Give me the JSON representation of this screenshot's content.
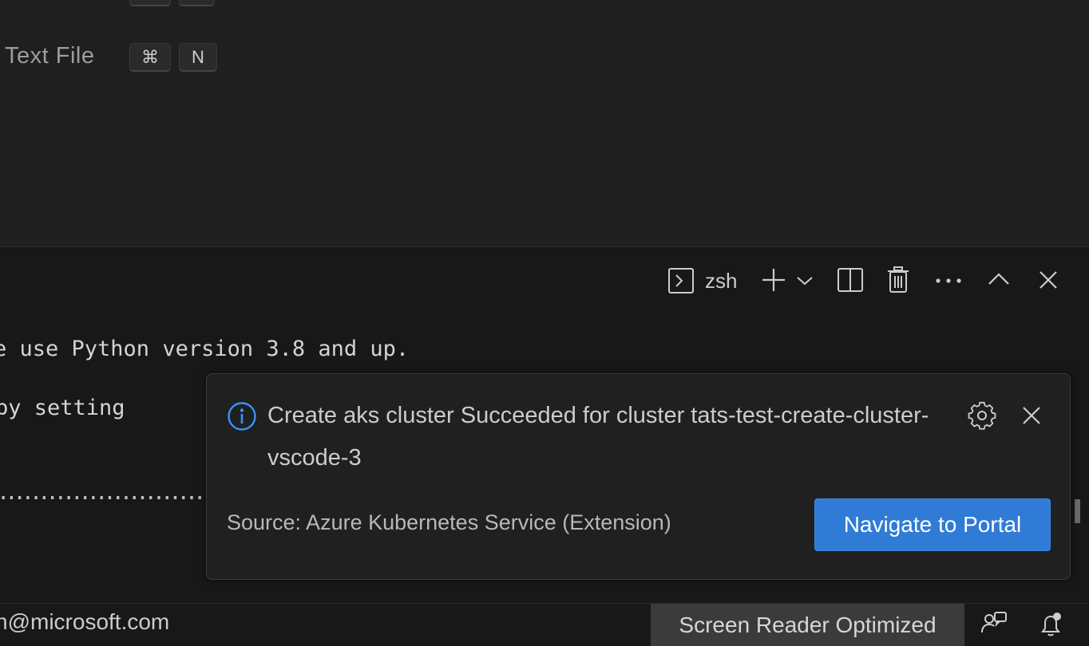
{
  "editor": {
    "shortcuts_top": [
      "",
      ""
    ],
    "new_file_label": "Text File",
    "new_file_keys": [
      "⌘",
      "N"
    ]
  },
  "terminal": {
    "shell_label": "zsh",
    "toolbar": {
      "terminal_icon": "terminal-icon",
      "new_terminal_icon": "plus-icon",
      "dropdown_icon": "chevron-down-icon",
      "split_icon": "split-terminal-icon",
      "kill_icon": "trash-icon",
      "more_icon": "ellipsis-icon",
      "maximize_icon": "chevron-up-icon",
      "close_icon": "close-icon"
    },
    "lines": [
      "e use Python version 3.8 and up.",
      "by setting",
      "..........................."
    ]
  },
  "notification": {
    "info_icon": "info-icon",
    "message": "Create aks cluster Succeeded for cluster tats-test-create-cluster-vscode-3",
    "source": "Source: Azure Kubernetes Service (Extension)",
    "action_label": "Navigate to Portal",
    "settings_icon": "gear-icon",
    "close_icon": "close-icon",
    "accent_color": "#2f7bd6",
    "info_color": "#3794ff"
  },
  "statusbar": {
    "account": "n@microsoft.com",
    "screen_reader": "Screen Reader Optimized",
    "feedback_icon": "feedback-icon",
    "notifications_icon": "bell-icon"
  }
}
